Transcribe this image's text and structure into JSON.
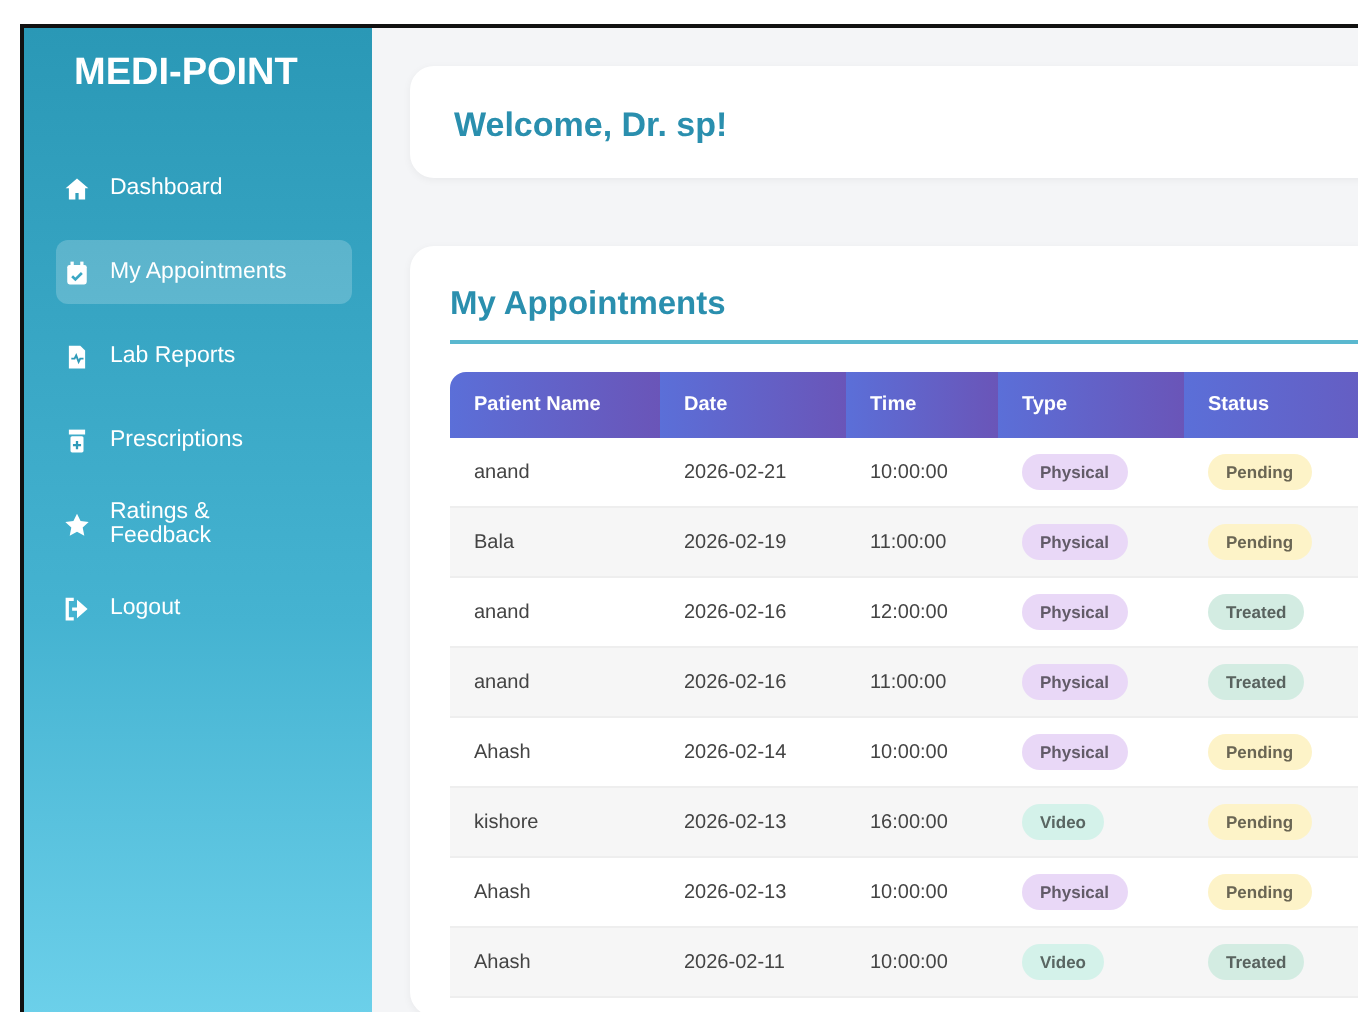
{
  "sidebar": {
    "logo": "MEDI-POINT",
    "items": [
      {
        "label": "Dashboard",
        "selected": false
      },
      {
        "label": "My Appointments",
        "selected": true
      },
      {
        "label": "Lab Reports",
        "selected": false
      },
      {
        "label": "Prescriptions",
        "selected": false
      },
      {
        "label": "Ratings & Feedback",
        "selected": false
      },
      {
        "label": "Logout",
        "selected": false
      }
    ]
  },
  "welcome": {
    "title": "Welcome, Dr. sp!"
  },
  "appointments": {
    "title": "My Appointments",
    "table": {
      "columns": [
        "Patient Name",
        "Date",
        "Time",
        "Type",
        "Status"
      ],
      "rows": [
        {
          "patient": "anand",
          "date": "2026-02-21",
          "time": "10:00:00",
          "type": {
            "text": "Physical",
            "color": "#e9d8f7"
          },
          "status": {
            "text": "Pending",
            "color": "#fdf3c8"
          }
        },
        {
          "patient": "Bala",
          "date": "2026-02-19",
          "time": "11:00:00",
          "type": {
            "text": "Physical",
            "color": "#e9d8f7"
          },
          "status": {
            "text": "Pending",
            "color": "#fdf3c8"
          }
        },
        {
          "patient": "anand",
          "date": "2026-02-16",
          "time": "12:00:00",
          "type": {
            "text": "Physical",
            "color": "#e9d8f7"
          },
          "status": {
            "text": "Treated",
            "color": "#d3ece2"
          }
        },
        {
          "patient": "anand",
          "date": "2026-02-16",
          "time": "11:00:00",
          "type": {
            "text": "Physical",
            "color": "#e9d8f7"
          },
          "status": {
            "text": "Treated",
            "color": "#d3ece2"
          }
        },
        {
          "patient": "Ahash",
          "date": "2026-02-14",
          "time": "10:00:00",
          "type": {
            "text": "Physical",
            "color": "#e9d8f7"
          },
          "status": {
            "text": "Pending",
            "color": "#fdf3c8"
          }
        },
        {
          "patient": "kishore",
          "date": "2026-02-13",
          "time": "16:00:00",
          "type": {
            "text": "Video",
            "color": "#d4f2ea"
          },
          "status": {
            "text": "Pending",
            "color": "#fdf3c8"
          }
        },
        {
          "patient": "Ahash",
          "date": "2026-02-13",
          "time": "10:00:00",
          "type": {
            "text": "Physical",
            "color": "#e9d8f7"
          },
          "status": {
            "text": "Pending",
            "color": "#fdf3c8"
          }
        },
        {
          "patient": "Ahash",
          "date": "2026-02-11",
          "time": "10:00:00",
          "type": {
            "text": "Video",
            "color": "#d4f2ea"
          },
          "status": {
            "text": "Treated",
            "color": "#d3ece2"
          }
        }
      ]
    }
  }
}
